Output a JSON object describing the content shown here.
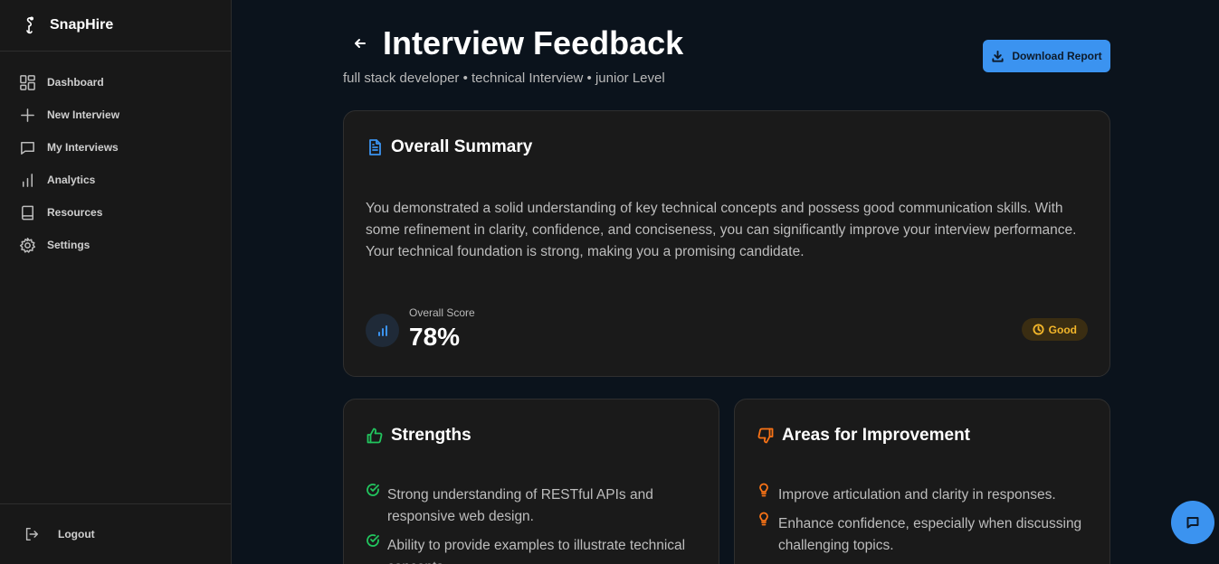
{
  "app": {
    "name": "SnapHire"
  },
  "sidebar": {
    "items": [
      {
        "label": "Dashboard",
        "icon": "dashboard-icon"
      },
      {
        "label": "New Interview",
        "icon": "plus-icon"
      },
      {
        "label": "My Interviews",
        "icon": "chat-icon"
      },
      {
        "label": "Analytics",
        "icon": "bar-chart-icon"
      },
      {
        "label": "Resources",
        "icon": "book-icon"
      },
      {
        "label": "Settings",
        "icon": "gear-icon"
      }
    ],
    "logout_label": "Logout"
  },
  "header": {
    "title": "Interview Feedback",
    "subtitle": "full stack developer • technical Interview • junior Level",
    "download_label": "Download Report"
  },
  "summary": {
    "title": "Overall Summary",
    "text": "You demonstrated a solid understanding of key technical concepts and possess good communication skills. With some refinement in clarity, confidence, and conciseness, you can significantly improve your interview performance. Your technical foundation is strong, making you a promising candidate.",
    "score_label": "Overall Score",
    "score_value": "78%",
    "rating": "Good"
  },
  "strengths": {
    "title": "Strengths",
    "items": [
      "Strong understanding of RESTful APIs and responsive web design.",
      "Ability to provide examples to illustrate technical concepts."
    ]
  },
  "improvements": {
    "title": "Areas for Improvement",
    "items": [
      "Improve articulation and clarity in responses.",
      "Enhance confidence, especially when discussing challenging topics."
    ]
  },
  "colors": {
    "accent": "#3b93f0",
    "success": "#22c55e",
    "warning": "#f3b62a",
    "orange": "#f97316",
    "background": "#0b131c",
    "card": "#1a1a1a"
  }
}
